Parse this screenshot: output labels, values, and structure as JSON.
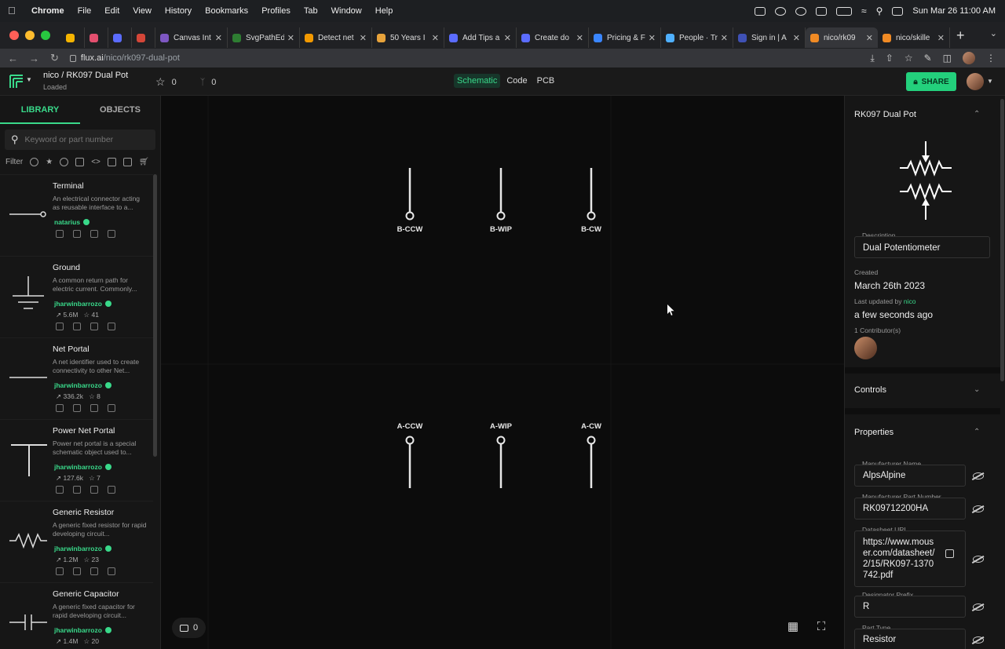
{
  "mac_menu": {
    "app": "Chrome",
    "items": [
      "File",
      "Edit",
      "View",
      "History",
      "Bookmarks",
      "Profiles",
      "Tab",
      "Window",
      "Help"
    ],
    "datetime": "Sun Mar 26  11:00 AM"
  },
  "browser": {
    "tabs": [
      {
        "title": "",
        "color": "#f5b400"
      },
      {
        "title": "",
        "color": "#e34f6f"
      },
      {
        "title": "",
        "color": "#5b6cff"
      },
      {
        "title": "",
        "color": "#d44638"
      },
      {
        "title": "Canvas Int",
        "color": "#7e57c2"
      },
      {
        "title": "SvgPathEd",
        "color": "#2e7d32"
      },
      {
        "title": "Detect net",
        "color": "#f29900"
      },
      {
        "title": "50 Years I",
        "color": "#e8a33b"
      },
      {
        "title": "Add Tips a",
        "color": "#5b6cff"
      },
      {
        "title": "Create do",
        "color": "#5b6cff"
      },
      {
        "title": "Pricing & F",
        "color": "#3a86ff"
      },
      {
        "title": "People · Tr",
        "color": "#4fb0ff"
      },
      {
        "title": "Sign in | A",
        "color": "#3f51b5"
      },
      {
        "title": "nico/rk09",
        "color": "#f08a24"
      },
      {
        "title": "nico/skille",
        "color": "#f08a24"
      }
    ],
    "url_host": "flux.ai",
    "url_path": "/nico/rk097-dual-pot"
  },
  "app": {
    "project_title": "nico / RK097 Dual Pot",
    "project_status": "Loaded",
    "stars": "0",
    "forks": "0",
    "view_tabs": [
      "Schematic",
      "Code",
      "PCB"
    ],
    "share_label": "SHARE"
  },
  "sidebar": {
    "tabs": [
      "LIBRARY",
      "OBJECTS"
    ],
    "search_placeholder": "Keyword or part number",
    "filter_label": "Filter",
    "items": [
      {
        "name": "Terminal",
        "desc": "An electrical connector acting as reusable interface to a...",
        "author": "natarius",
        "uses": "",
        "stars": ""
      },
      {
        "name": "Ground",
        "desc": "A common return path for electric current. Commonly...",
        "author": "jharwinbarrozo",
        "uses": "5.6M",
        "stars": "41"
      },
      {
        "name": "Net Portal",
        "desc": "A net identifier used to create connectivity to other Net...",
        "author": "jharwinbarrozo",
        "uses": "336.2k",
        "stars": "8"
      },
      {
        "name": "Power Net Portal",
        "desc": "Power net portal is a special schematic object used to...",
        "author": "jharwinbarrozo",
        "uses": "127.6k",
        "stars": "7"
      },
      {
        "name": "Generic Resistor",
        "desc": "A generic fixed resistor for rapid developing circuit...",
        "author": "jharwinbarrozo",
        "uses": "1.2M",
        "stars": "23"
      },
      {
        "name": "Generic Capacitor",
        "desc": "A generic fixed capacitor for rapid developing circuit...",
        "author": "jharwinbarrozo",
        "uses": "1.4M",
        "stars": "20"
      }
    ]
  },
  "canvas": {
    "pins_top": [
      "B-CCW",
      "B-WIP",
      "B-CW"
    ],
    "pins_bottom": [
      "A-CCW",
      "A-WIP",
      "A-CW"
    ],
    "comments": "0"
  },
  "inspector": {
    "title": "RK097 Dual Pot",
    "description_label": "Description",
    "description": "Dual Potentiometer",
    "created_label": "Created",
    "created": "March 26th 2023",
    "updated_label": "Last updated by",
    "updated_by": "nico",
    "updated": "a few seconds ago",
    "contributors": "1 Contributor(s)",
    "controls": "Controls",
    "properties": "Properties",
    "fields": [
      {
        "label": "Manufacturer Name",
        "value": "AlpsAlpine"
      },
      {
        "label": "Manufacturer Part Number",
        "value": "RK09712200HA"
      },
      {
        "label": "Datasheet URL",
        "value": "https://www.mouser.com/datasheet/2/15/RK097-1370742.pdf"
      },
      {
        "label": "Designator Prefix",
        "value": "R"
      },
      {
        "label": "Part Type",
        "value": "Resistor"
      }
    ]
  }
}
